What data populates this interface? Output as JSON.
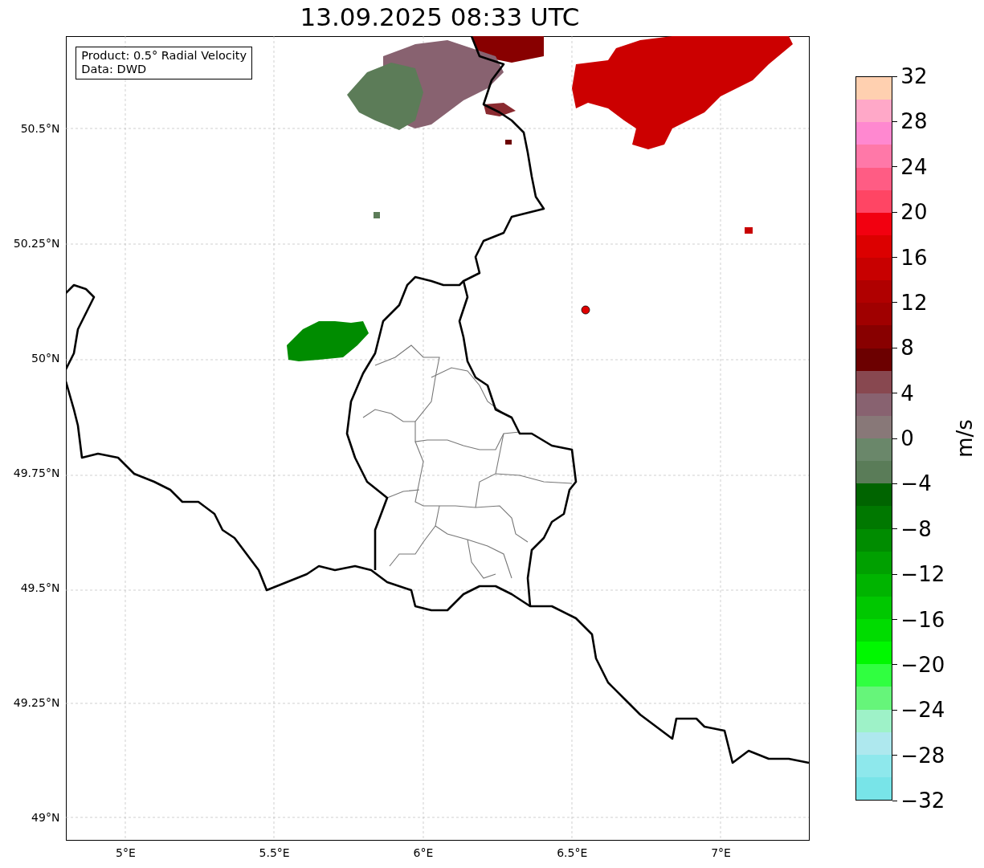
{
  "title": "13.09.2025 08:33 UTC",
  "info_box": [
    "Product: 0.5° Radial Velocity",
    "Data: DWD"
  ],
  "map": {
    "lat_ticks": [
      "50.5°N",
      "50.25°N",
      "50°N",
      "49.75°N",
      "49.5°N",
      "49.25°N",
      "49°N"
    ],
    "lon_ticks": [
      "5°E",
      "5.5°E",
      "6°E",
      "6.5°E",
      "7°E"
    ]
  },
  "colorbar": {
    "label": "m/s",
    "ticks": [
      "32",
      "28",
      "24",
      "20",
      "16",
      "12",
      "8",
      "4",
      "0",
      "−4",
      "−8",
      "−12",
      "−16",
      "−20",
      "−24",
      "−28",
      "−32"
    ],
    "bands": [
      {
        "color": "#ffd0b0"
      },
      {
        "color": "#ffa8c8"
      },
      {
        "color": "#ff88d0"
      },
      {
        "color": "#ff78a8"
      },
      {
        "color": "#ff5c84"
      },
      {
        "color": "#ff4564"
      },
      {
        "color": "#f20010"
      },
      {
        "color": "#dc0000"
      },
      {
        "color": "#c80000"
      },
      {
        "color": "#b00000"
      },
      {
        "color": "#a00000"
      },
      {
        "color": "#880000"
      },
      {
        "color": "#6c0000"
      },
      {
        "color": "#884850"
      },
      {
        "color": "#886270"
      },
      {
        "color": "#887878"
      },
      {
        "color": "#6a876a"
      },
      {
        "color": "#5a7c58"
      },
      {
        "color": "#006400"
      },
      {
        "color": "#007800"
      },
      {
        "color": "#008c00"
      },
      {
        "color": "#00a000"
      },
      {
        "color": "#00b400"
      },
      {
        "color": "#00c800"
      },
      {
        "color": "#00dc00"
      },
      {
        "color": "#00f800"
      },
      {
        "color": "#30ff40"
      },
      {
        "color": "#66f57a"
      },
      {
        "color": "#9ef2c8"
      },
      {
        "color": "#aee8ee"
      },
      {
        "color": "#8ee8ec"
      },
      {
        "color": "#78e4e8"
      }
    ]
  }
}
